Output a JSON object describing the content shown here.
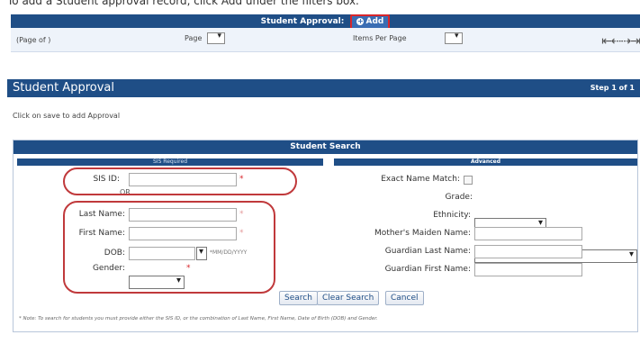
{
  "top_instruction": "To add a Student approval record, click Add under the filters box.",
  "approval_bar": {
    "title": "Student Approval:",
    "add_label": "Add"
  },
  "pager": {
    "page_of": "(Page of )",
    "page_label": "Page",
    "items_per_page_label": "Items Per Page",
    "nav": "⇤⇠⇢⇥"
  },
  "panel": {
    "title": "Student Approval",
    "step": "Step 1 of 1",
    "hint": "Click on save to add Approval"
  },
  "search": {
    "title": "Student Search",
    "left_header": "SIS Required",
    "right_header": "Advanced",
    "or_label": "OR",
    "sis_id_label": "SIS ID:",
    "last_name_label": "Last Name:",
    "first_name_label": "First Name:",
    "dob_label": "DOB:",
    "dob_hint": "*MM/DD/YYYY",
    "gender_label": "Gender:",
    "required_mark": "*",
    "exact_name_label": "Exact Name Match:",
    "grade_label": "Grade:",
    "ethnicity_label": "Ethnicity:",
    "mothers_maiden_label": "Mother's Maiden Name:",
    "guardian_last_label": "Guardian Last Name:",
    "guardian_first_label": "Guardian First Name:",
    "search_button": "Search",
    "clear_button": "Clear Search",
    "cancel_button": "Cancel",
    "note": "* Note: To search for students you must provide either the SIS ID, or the combination of Last Name, First Name, Date of Birth (DOB) and Gender."
  },
  "colors": {
    "header_blue": "#1f4e86",
    "highlight_red": "#c0393b"
  }
}
